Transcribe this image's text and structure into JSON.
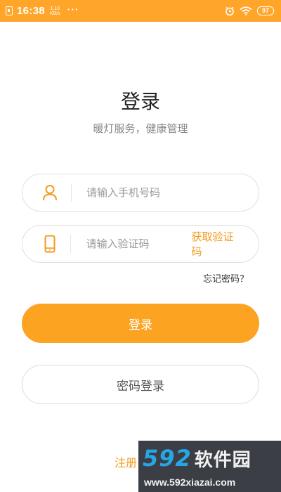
{
  "status_bar": {
    "time": "16:38",
    "net_speed_value": "1.10",
    "net_speed_unit": "KB/s",
    "more": "···",
    "battery": "97"
  },
  "login": {
    "title": "登录",
    "subtitle": "暖灯服务，健康管理",
    "phone_placeholder": "请输入手机号码",
    "code_placeholder": "请输入验证码",
    "get_code": "获取验证码",
    "forgot": "忘记密码？",
    "login_button": "登录",
    "password_login_button": "密码登录",
    "register": "注册"
  },
  "colors": {
    "accent": "#fca322",
    "status_bar": "#ffa52a"
  },
  "watermark": {
    "brand_number": "592",
    "brand_text": "软件园",
    "url": "www.592xiazai.com"
  }
}
